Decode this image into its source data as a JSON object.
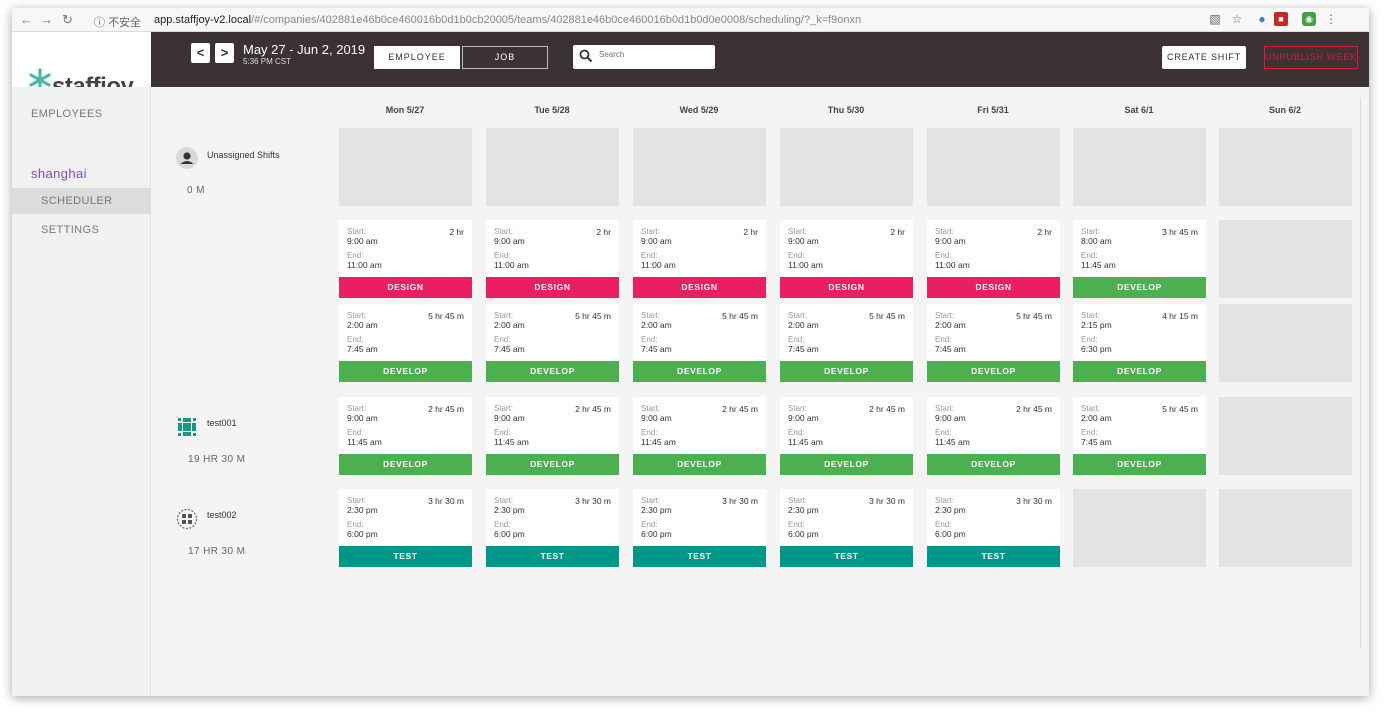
{
  "browser": {
    "security_label": "不安全",
    "url_host": "app.staffjoy-v2.local",
    "url_path": "/#/companies/402881e46b0ce460016b0d1b0cb20005/teams/402881e46b0ce460016b0d1b0d0e0008/scheduling/?_k=f9onxn"
  },
  "app": {
    "logo_text": "staffjoy",
    "brand_color": "#4cb9a8"
  },
  "sidebar": {
    "employees_label": "EMPLOYEES",
    "team_name": "shanghai",
    "scheduler_label": "SCHEDULER",
    "settings_label": "SETTINGS"
  },
  "toolbar": {
    "prev_label": "<",
    "next_label": ">",
    "date_range": "May 27 - Jun 2, 2019",
    "current_time": "5:36 PM CST",
    "view_employee": "EMPLOYEE",
    "view_job": "JOB",
    "search_placeholder": "Search",
    "create_shift": "CREATE SHIFT",
    "unpublish_week": "UNPUBLISH WEEK"
  },
  "days": [
    "Mon 5/27",
    "Tue 5/28",
    "Wed 5/29",
    "Thu 5/30",
    "Fri 5/31",
    "Sat 6/1",
    "Sun 6/2"
  ],
  "labels": {
    "start": "Start:",
    "end": "End:"
  },
  "job_colors": {
    "DESIGN": "#e91e63",
    "DEVELOP": "#4caf50",
    "TEST": "#009688"
  },
  "employees": [
    {
      "name": "Unassigned Shifts",
      "hours": "0 M"
    },
    {
      "name": "test001",
      "hours": "19 HR 30 M"
    },
    {
      "name": "test002",
      "hours": "17 HR 30 M"
    }
  ],
  "rows": [
    {
      "cells": [
        null,
        null,
        null,
        null,
        null,
        null,
        null
      ]
    },
    {
      "cells": [
        {
          "start": "9:00 am",
          "end": "11:00 am",
          "duration": "2 hr",
          "job": "DESIGN"
        },
        {
          "start": "9:00 am",
          "end": "11:00 am",
          "duration": "2 hr",
          "job": "DESIGN"
        },
        {
          "start": "9:00 am",
          "end": "11:00 am",
          "duration": "2 hr",
          "job": "DESIGN"
        },
        {
          "start": "9:00 am",
          "end": "11:00 am",
          "duration": "2 hr",
          "job": "DESIGN"
        },
        {
          "start": "9:00 am",
          "end": "11:00 am",
          "duration": "2 hr",
          "job": "DESIGN"
        },
        {
          "start": "8:00 am",
          "end": "11:45 am",
          "duration": "3 hr 45 m",
          "job": "DEVELOP"
        },
        null
      ]
    },
    {
      "cells": [
        {
          "start": "2:00 am",
          "end": "7:45 am",
          "duration": "5 hr 45 m",
          "job": "DEVELOP"
        },
        {
          "start": "2:00 am",
          "end": "7:45 am",
          "duration": "5 hr 45 m",
          "job": "DEVELOP"
        },
        {
          "start": "2:00 am",
          "end": "7:45 am",
          "duration": "5 hr 45 m",
          "job": "DEVELOP"
        },
        {
          "start": "2:00 am",
          "end": "7:45 am",
          "duration": "5 hr 45 m",
          "job": "DEVELOP"
        },
        {
          "start": "2:00 am",
          "end": "7:45 am",
          "duration": "5 hr 45 m",
          "job": "DEVELOP"
        },
        {
          "start": "2:15 pm",
          "end": "6:30 pm",
          "duration": "4 hr 15 m",
          "job": "DEVELOP"
        },
        null
      ]
    },
    {
      "cells": [
        {
          "start": "9:00 am",
          "end": "11:45 am",
          "duration": "2 hr 45 m",
          "job": "DEVELOP"
        },
        {
          "start": "9:00 am",
          "end": "11:45 am",
          "duration": "2 hr 45 m",
          "job": "DEVELOP"
        },
        {
          "start": "9:00 am",
          "end": "11:45 am",
          "duration": "2 hr 45 m",
          "job": "DEVELOP"
        },
        {
          "start": "9:00 am",
          "end": "11:45 am",
          "duration": "2 hr 45 m",
          "job": "DEVELOP"
        },
        {
          "start": "9:00 am",
          "end": "11:45 am",
          "duration": "2 hr 45 m",
          "job": "DEVELOP"
        },
        {
          "start": "2:00 am",
          "end": "7:45 am",
          "duration": "5 hr 45 m",
          "job": "DEVELOP"
        },
        null
      ]
    },
    {
      "cells": [
        {
          "start": "2:30 pm",
          "end": "6:00 pm",
          "duration": "3 hr 30 m",
          "job": "TEST"
        },
        {
          "start": "2:30 pm",
          "end": "6:00 pm",
          "duration": "3 hr 30 m",
          "job": "TEST"
        },
        {
          "start": "2:30 pm",
          "end": "6:00 pm",
          "duration": "3 hr 30 m",
          "job": "TEST"
        },
        {
          "start": "2:30 pm",
          "end": "6:00 pm",
          "duration": "3 hr 30 m",
          "job": "TEST"
        },
        {
          "start": "2:30 pm",
          "end": "6:00 pm",
          "duration": "3 hr 30 m",
          "job": "TEST"
        },
        null,
        null
      ]
    }
  ]
}
